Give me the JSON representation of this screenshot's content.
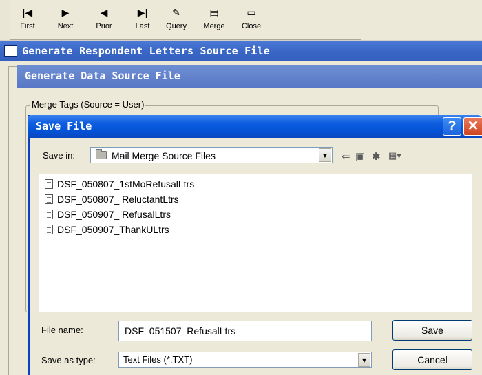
{
  "toolbar": {
    "buttons": [
      {
        "label": "First",
        "icon": "first-record-icon",
        "glyph": "|◀"
      },
      {
        "label": "Next",
        "icon": "next-record-icon",
        "glyph": "▶"
      },
      {
        "label": "Prior",
        "icon": "prior-record-icon",
        "glyph": "◀"
      },
      {
        "label": "Last",
        "icon": "last-record-icon",
        "glyph": "▶|"
      },
      {
        "label": "Query",
        "icon": "query-icon",
        "glyph": "✎"
      },
      {
        "label": "Merge",
        "icon": "merge-icon",
        "glyph": "▤"
      },
      {
        "label": "Close",
        "icon": "close-folder-icon",
        "glyph": "▭"
      }
    ]
  },
  "window_outer": {
    "title": "Generate Respondent Letters Source File"
  },
  "window_inner": {
    "title": "Generate Data Source File"
  },
  "groupbox": {
    "label": "Merge Tags (Source = User)"
  },
  "dialog": {
    "title": "Save File",
    "help_glyph": "?",
    "close_glyph": "✕",
    "save_in_label": "Save in:",
    "save_in_value": "Mail Merge Source Files",
    "files": [
      "DSF_050807_1stMoRefusalLtrs",
      "DSF_050807_ ReluctantLtrs",
      "DSF_050907_ RefusalLtrs",
      "DSF_050907_ThankULtrs"
    ],
    "file_name_label": "File name:",
    "file_name_value": "DSF_051507_RefusalLtrs",
    "save_as_type_label": "Save as type:",
    "save_as_type_value": "Text Files (*.TXT)",
    "save_button": "Save",
    "cancel_button": "Cancel"
  },
  "colors": {
    "dialog_title_blue": "#0452d6",
    "outer_title_blue": "#3a67c6",
    "dialog_face": "#ece9d8"
  }
}
